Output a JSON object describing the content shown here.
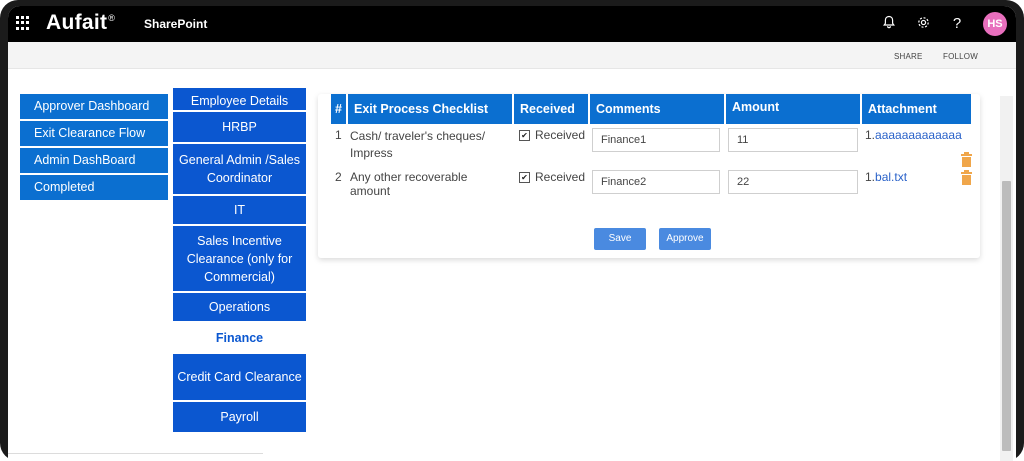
{
  "suitebar": {
    "brand": "Aufait",
    "brand_mark": "®",
    "site": "SharePoint",
    "avatar_initials": "HS"
  },
  "commandbar": {
    "share": "SHARE",
    "follow": "FOLLOW"
  },
  "left_nav": [
    {
      "label": "Approver Dashboard"
    },
    {
      "label": "Exit Clearance Flow"
    },
    {
      "label": "Admin DashBoard"
    },
    {
      "label": "Completed"
    }
  ],
  "mid_nav": [
    {
      "label": "Employee Details"
    },
    {
      "label": "HRBP"
    },
    {
      "label": "General Admin /Sales Coordinator"
    },
    {
      "label": "IT"
    },
    {
      "label": "Sales Incentive Clearance (only for Commercial)"
    },
    {
      "label": "Operations"
    },
    {
      "label": "Finance",
      "active": true
    },
    {
      "label": "Credit Card Clearance"
    },
    {
      "label": "Payroll"
    }
  ],
  "table": {
    "headers": [
      "#",
      "Exit Process Checklist",
      "Received",
      "Comments",
      "Amount",
      "Attachment"
    ],
    "rows": [
      {
        "num": "1",
        "item": "Cash/ traveler's cheques/ Impress",
        "received_label": "Received",
        "received": true,
        "comment": "Finance1",
        "amount": "11",
        "attachment_index": "1.",
        "attachment": "aaaaaaaaaaaaa"
      },
      {
        "num": "2",
        "item": "Any other recoverable amount",
        "received_label": "Received",
        "received": true,
        "comment": "Finance2",
        "amount": "22",
        "attachment_index": "1.",
        "attachment": "bal.txt"
      }
    ]
  },
  "buttons": {
    "save": "Save",
    "approve": "Approve"
  },
  "colors": {
    "nav_blue": "#0b6fd0",
    "tab_blue": "#0b57d0",
    "button_blue": "#4a8ae0",
    "trash_orange": "#f0a64a",
    "avatar_pink": "#e86fbd"
  },
  "icons": [
    "app-launcher-icon",
    "bell-icon",
    "gear-icon",
    "help-icon",
    "trash-icon"
  ]
}
